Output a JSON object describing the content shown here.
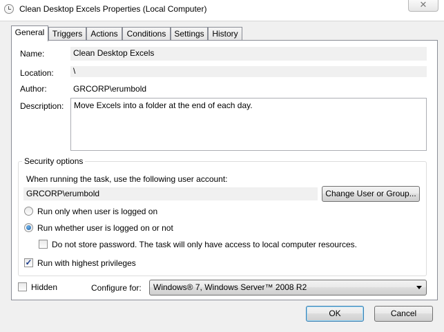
{
  "window": {
    "title": "Clean Desktop Excels Properties (Local Computer)",
    "close_glyph": "✕"
  },
  "tabs": [
    {
      "label": "General",
      "active": true
    },
    {
      "label": "Triggers"
    },
    {
      "label": "Actions"
    },
    {
      "label": "Conditions"
    },
    {
      "label": "Settings"
    },
    {
      "label": "History"
    }
  ],
  "general": {
    "name_label": "Name:",
    "name_value": "Clean Desktop Excels",
    "location_label": "Location:",
    "location_value": "\\",
    "author_label": "Author:",
    "author_value": "GRCORP\\erumbold",
    "description_label": "Description:",
    "description_value": "Move Excels into a folder at the end of each day."
  },
  "security": {
    "group_title": "Security options",
    "account_prompt": "When running the task, use the following user account:",
    "account_value": "GRCORP\\erumbold",
    "change_button": "Change User or Group...",
    "radio_logged_on": "Run only when user is logged on",
    "radio_whether": "Run whether user is logged on or not",
    "selected_radio": "whether",
    "no_store_password": "Do not store password.  The task will only have access to local computer resources.",
    "no_store_checked": false,
    "highest_privileges": "Run with highest privileges",
    "highest_checked": true
  },
  "bottom": {
    "hidden_label": "Hidden",
    "hidden_checked": false,
    "configure_label": "Configure for:",
    "configure_value": "Windows® 7, Windows Server™ 2008 R2"
  },
  "buttons": {
    "ok": "OK",
    "cancel": "Cancel"
  },
  "check_glyph": "✓"
}
